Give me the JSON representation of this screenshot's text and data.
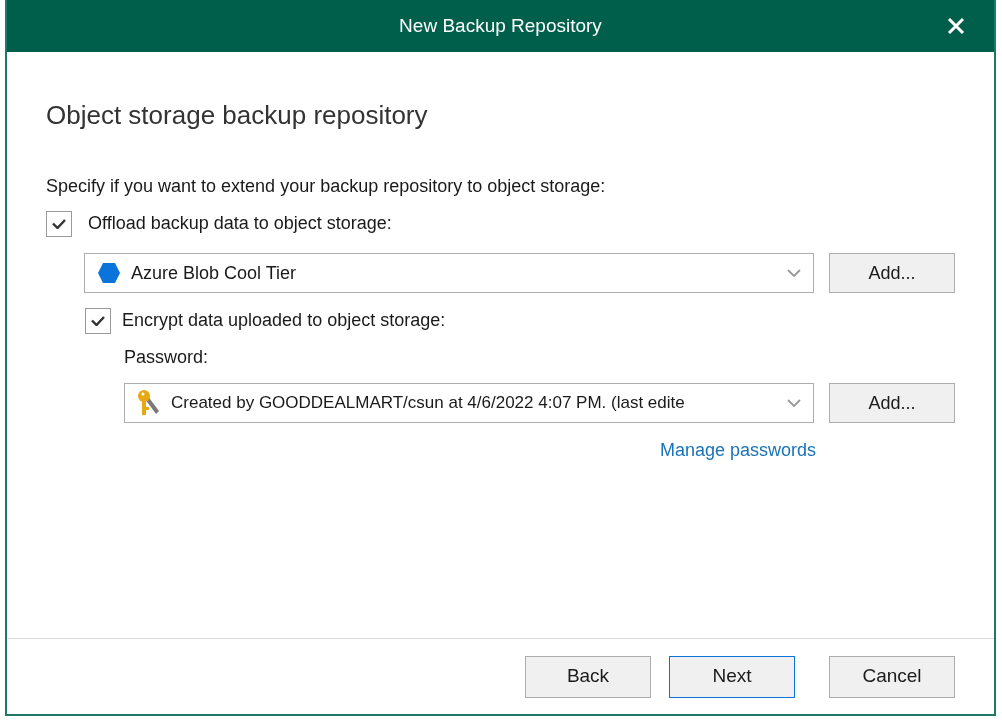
{
  "window": {
    "title": "New Backup Repository"
  },
  "heading": "Object storage backup repository",
  "instruction": "Specify if you want to extend your backup repository to object storage:",
  "offload": {
    "label": "Offload backup data to object storage:",
    "checked": true,
    "repository": {
      "value": "Azure Blob Cool Tier"
    },
    "add_button": "Add..."
  },
  "encrypt": {
    "label": "Encrypt data uploaded to object storage:",
    "checked": true,
    "password_label": "Password:",
    "password": {
      "value": "Created by GOODDEALMART/csun at 4/6/2022 4:07 PM. (last edite"
    },
    "add_button": "Add...",
    "manage_link": "Manage passwords"
  },
  "buttons": [
    {
      "label": "Back",
      "focused": false
    },
    {
      "label": "Next",
      "focused": true
    },
    {
      "label": "Cancel",
      "focused": false
    }
  ]
}
